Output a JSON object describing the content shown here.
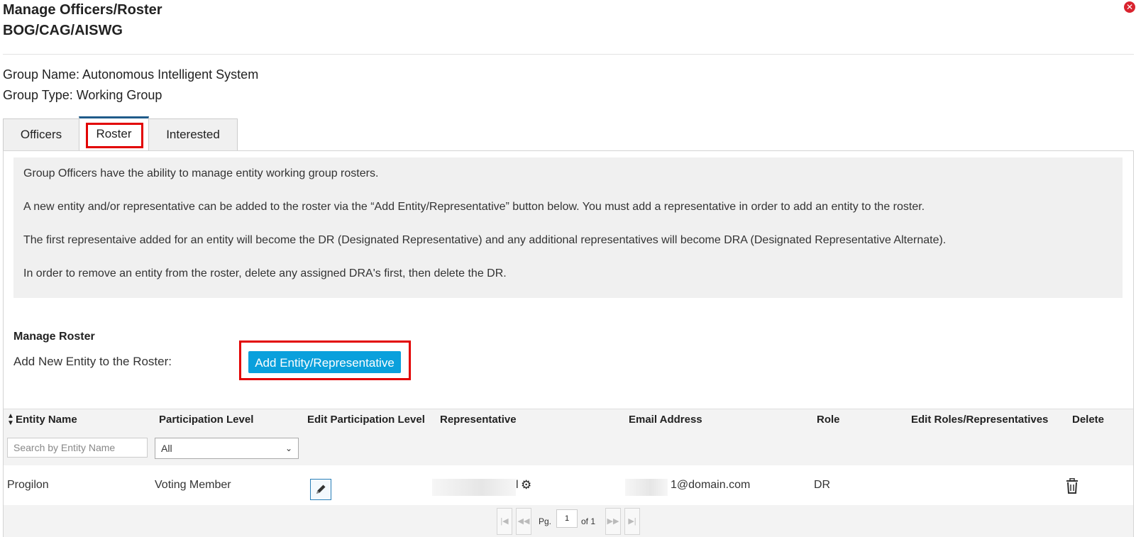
{
  "header": {
    "title_line1": "Manage Officers/Roster",
    "title_line2": "BOG/CAG/AISWG",
    "close_icon": "close-icon"
  },
  "group": {
    "name_line": "Group Name: Autonomous Intelligent System",
    "type_line": "Group Type: Working Group"
  },
  "tabs": [
    {
      "label": "Officers",
      "active": false
    },
    {
      "label": "Roster",
      "active": true
    },
    {
      "label": "Interested",
      "active": false
    }
  ],
  "notes": [
    "Group Officers have the ability to manage entity working group rosters.",
    "A new entity and/or representative can be added to the roster via the “Add Entity/Representative” button below. You must add a representative in order to add an entity to the roster.",
    "The first representaive added for an entity will become the DR (Designated Representative) and any additional representatives will become DRA (Designated Representative Alternate).",
    "In order to remove an entity from the roster, delete any assigned DRA's first, then delete the DR."
  ],
  "manage": {
    "title": "Manage Roster",
    "add_label": "Add New Entity to the Roster:",
    "add_button": "Add Entity/Representative"
  },
  "table": {
    "columns": [
      "Entity Name",
      "Participation Level",
      "Edit Participation Level",
      "Representative",
      "Email Address",
      "Role",
      "Edit Roles/Representatives",
      "Delete"
    ],
    "search_placeholder": "Search by Entity Name",
    "filter_selected": "All",
    "rows": [
      {
        "entity": "Progilon",
        "participation": "Voting Member",
        "representative_tail": "l",
        "email_tail": "1@domain.com",
        "role": "DR"
      }
    ]
  },
  "pager": {
    "pg_label": "Pg.",
    "current": "1",
    "of_label": "of 1"
  },
  "colors": {
    "highlight": "#e20000",
    "button": "#0aa0dc",
    "active_tab_border": "#1f5c8a"
  }
}
